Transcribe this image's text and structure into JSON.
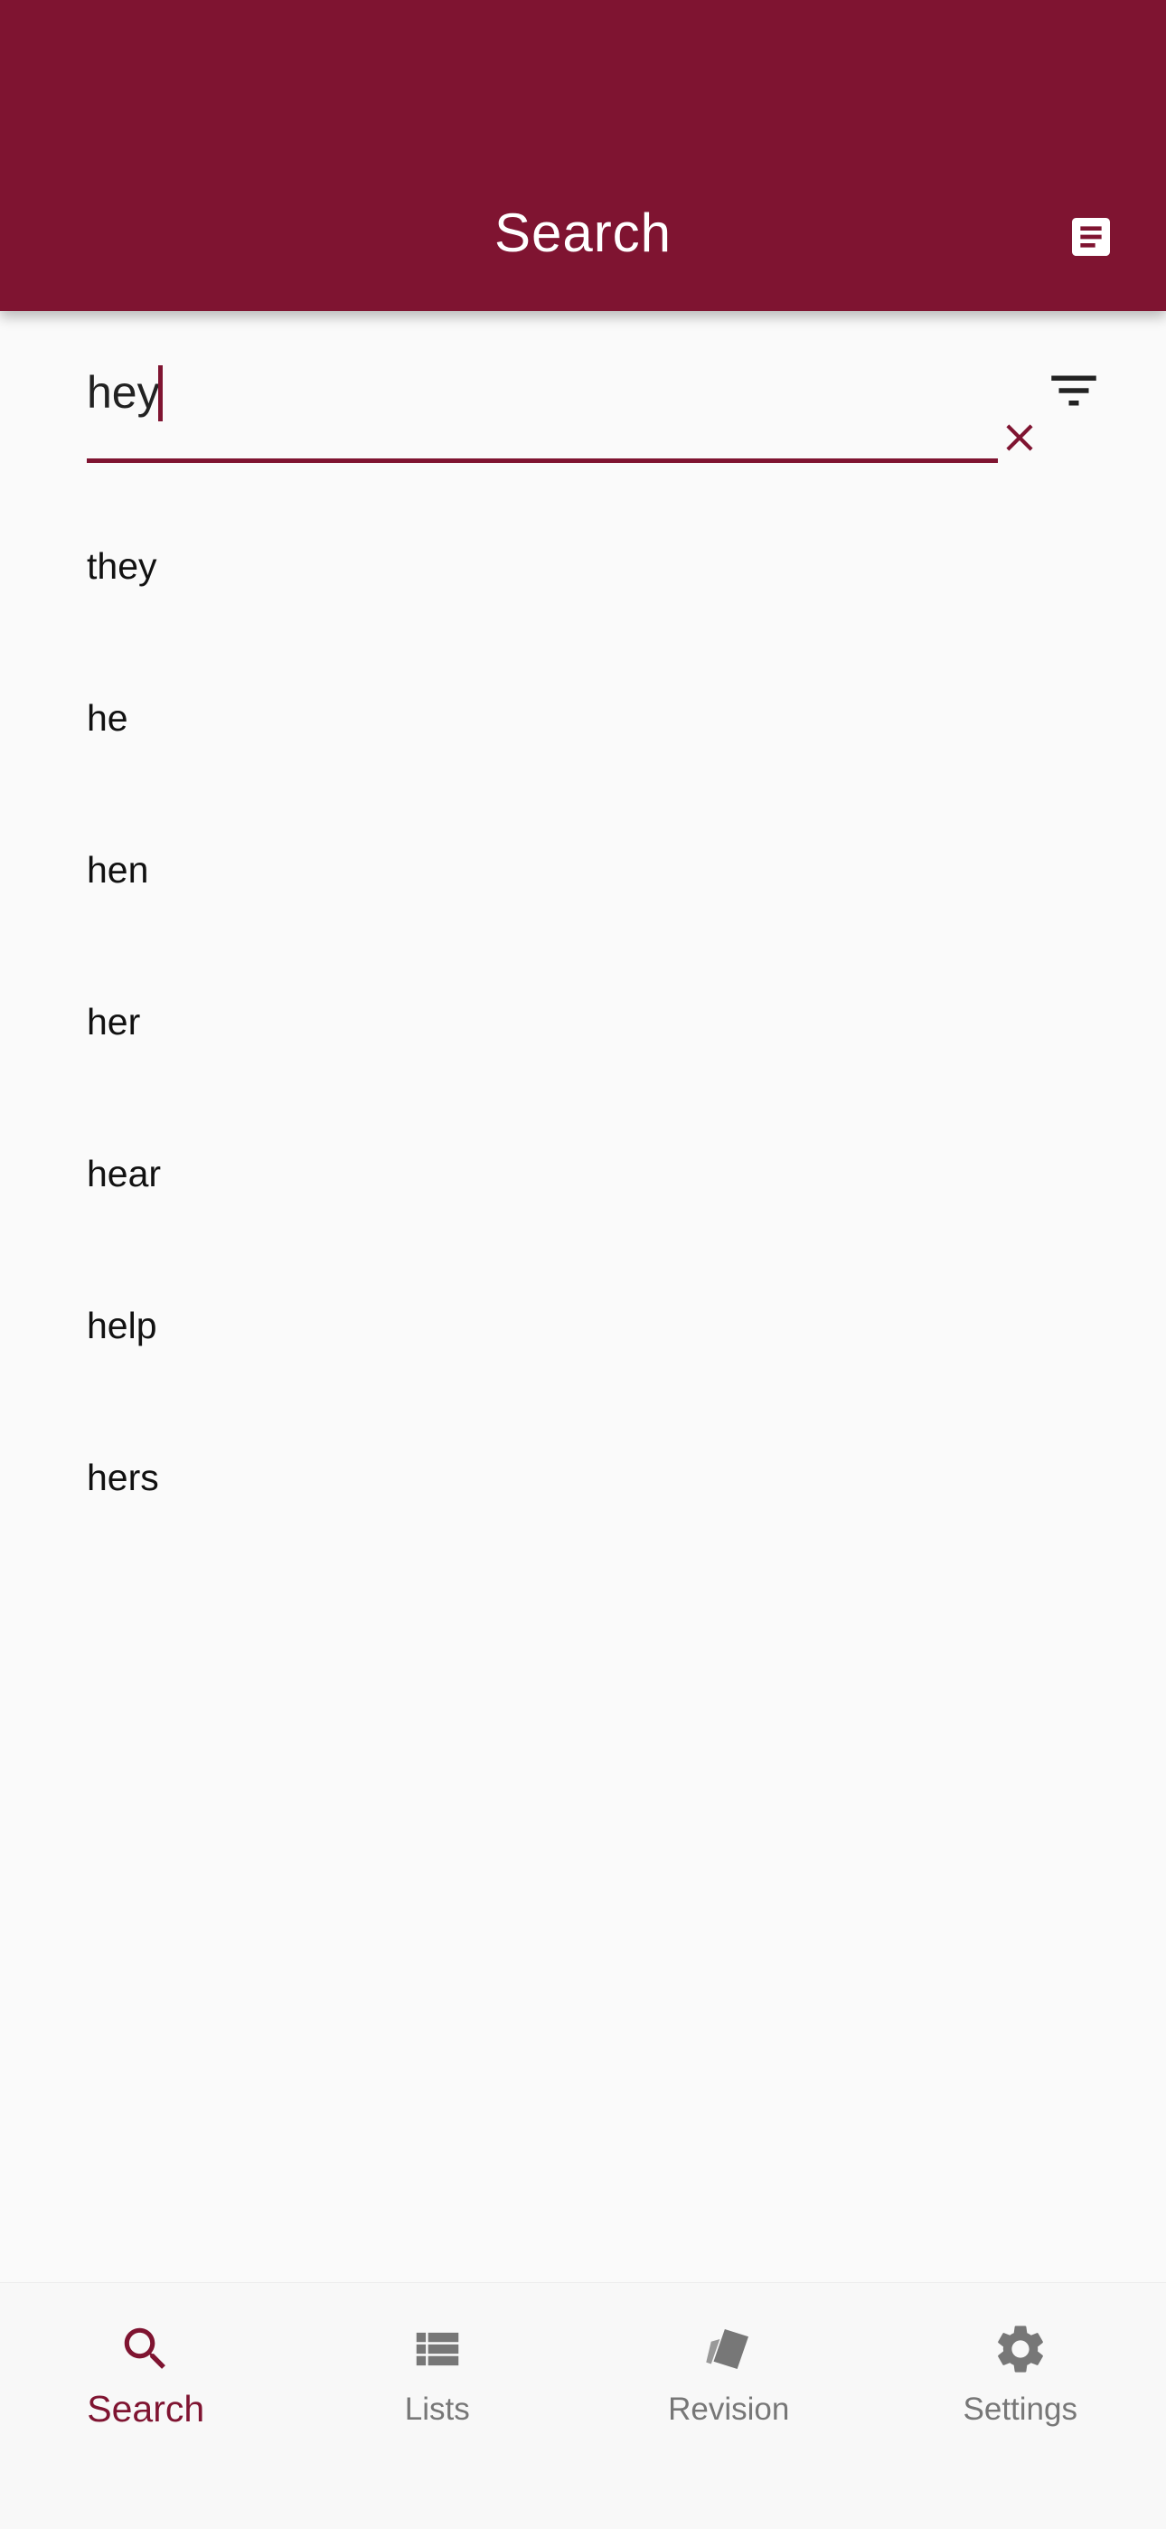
{
  "app_bar": {
    "title": "Search",
    "action_icon": "notes-icon"
  },
  "search": {
    "value": "hey",
    "clear_icon": "close-icon",
    "filter_icon": "filter-icon"
  },
  "results": [
    "they",
    "he",
    "hen",
    "her",
    "hear",
    "help",
    "hers"
  ],
  "bottom_nav": {
    "active": "search",
    "items": [
      {
        "id": "search",
        "label": "Search",
        "icon": "search-icon"
      },
      {
        "id": "lists",
        "label": "Lists",
        "icon": "list-icon"
      },
      {
        "id": "revision",
        "label": "Revision",
        "icon": "cards-icon"
      },
      {
        "id": "settings",
        "label": "Settings",
        "icon": "gear-icon"
      }
    ]
  },
  "colors": {
    "primary": "#7f1431",
    "background": "#fafafa",
    "inactive": "#777777"
  }
}
